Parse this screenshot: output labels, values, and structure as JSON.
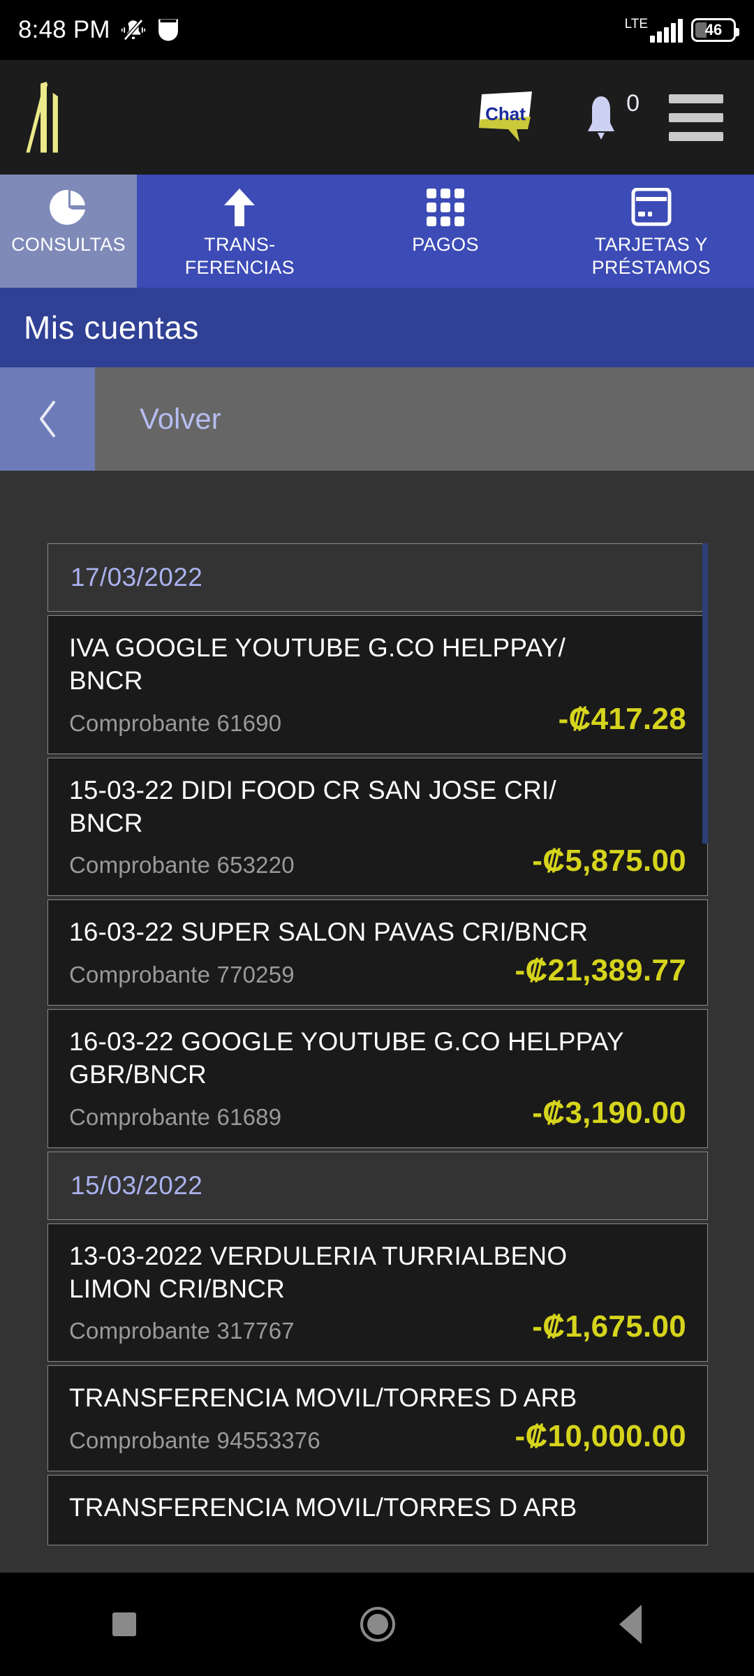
{
  "statusbar": {
    "clock": "8:48 PM",
    "mute_icon": "bell-muted-icon",
    "shield_icon": "shield-icon",
    "network": "LTE",
    "battery_level": "46"
  },
  "appbar": {
    "logo": "bncr-logo",
    "chat_label": "Chat",
    "notification_count": "0",
    "menu_icon": "hamburger-menu-icon"
  },
  "tabs": [
    {
      "label": "CONSULTAS",
      "icon": "pie-chart-icon",
      "active": true
    },
    {
      "label": "TRANS-\nFERENCIAS",
      "icon": "up-arrow-icon",
      "active": false
    },
    {
      "label": "PAGOS",
      "icon": "grid-9-icon",
      "active": false
    },
    {
      "label": "TARJETAS Y\nPRÉSTAMOS",
      "icon": "credit-card-icon",
      "active": false
    }
  ],
  "page": {
    "title": "Mis cuentas",
    "back_label": "Volver",
    "back_icon": "chevron-left-icon"
  },
  "transactions": [
    {
      "type": "date",
      "date": "17/03/2022"
    },
    {
      "type": "txn",
      "title": "IVA GOOGLE YOUTUBE G.CO HELPPAY/\nBNCR",
      "ref": "Comprobante 61690",
      "amount": "-₡417.28"
    },
    {
      "type": "txn",
      "title": "15-03-22 DIDI FOOD CR SAN JOSE CRI/\nBNCR",
      "ref": "Comprobante 653220",
      "amount": "-₡5,875.00"
    },
    {
      "type": "txn",
      "title": "16-03-22 SUPER SALON PAVAS CRI/BNCR",
      "ref": "Comprobante 770259",
      "amount": "-₡21,389.77"
    },
    {
      "type": "txn",
      "title": "16-03-22 GOOGLE YOUTUBE G.CO HELPPAY\nGBR/BNCR",
      "ref": "Comprobante 61689",
      "amount": "-₡3,190.00"
    },
    {
      "type": "date",
      "date": "15/03/2022"
    },
    {
      "type": "txn",
      "title": "13-03-2022 VERDULERIA TURRIALBENO\nLIMON        CRI/BNCR",
      "ref": "Comprobante 317767",
      "amount": "-₡1,675.00"
    },
    {
      "type": "txn",
      "title": "TRANSFERENCIA MOVIL/TORRES D ARB",
      "ref": "Comprobante 94553376",
      "amount": "-₡10,000.00"
    },
    {
      "type": "txn",
      "title": "TRANSFERENCIA MOVIL/TORRES D ARB",
      "ref": "",
      "amount": "",
      "partial": true
    }
  ],
  "navbar": {
    "recents_icon": "square-recents-icon",
    "home_icon": "circle-home-icon",
    "back_icon": "triangle-back-icon"
  },
  "colors": {
    "tab_bar": "#3c4bb5",
    "tab_active": "#7f8ab9",
    "title_bar": "#2f4095",
    "back_bar": "#666666",
    "back_button": "#6d7cb8",
    "amount": "#d6d41c",
    "date_text": "#aab2ee",
    "page_bg": "#333333",
    "card_bg": "#1a1a1a",
    "logo": "#ece98a"
  }
}
